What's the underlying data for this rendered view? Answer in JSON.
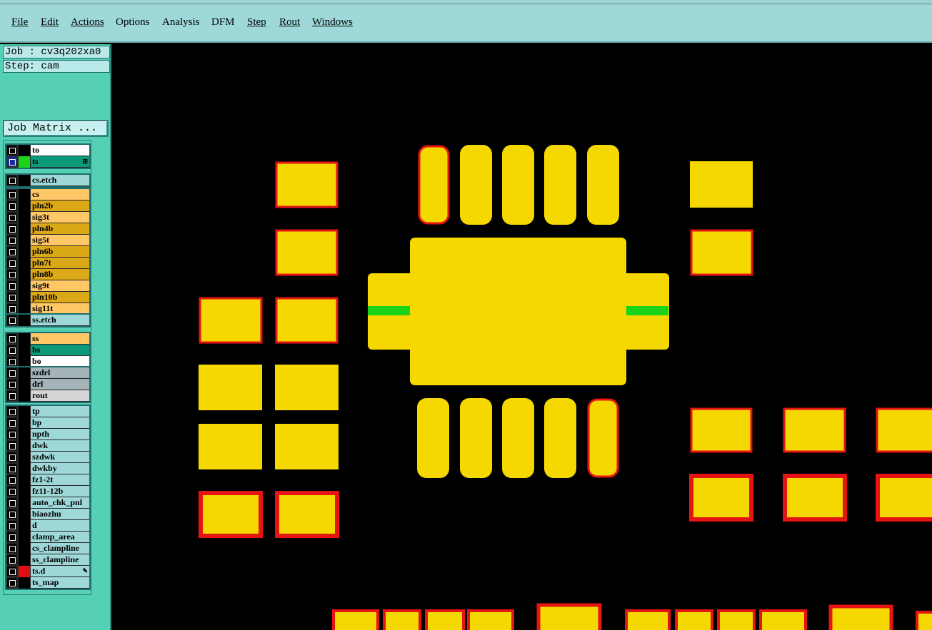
{
  "menu": [
    "File",
    "Edit",
    "Actions",
    "Options",
    "Analysis",
    "DFM",
    "Step",
    "Rout",
    "Windows"
  ],
  "job_label": "Job : cv3q202xa0",
  "step_label": "Step: cam",
  "job_matrix_label": "Job Matrix ...",
  "layer_groups": [
    [
      {
        "name": "to",
        "bg": "#ffffff"
      },
      {
        "name": "ts",
        "bg": "#0a9a7a",
        "swatch": "#19d419",
        "selected": true,
        "mark": "⊞"
      }
    ],
    [
      {
        "name": "cs.etch",
        "bg": "#9ed8d8"
      }
    ],
    [
      {
        "name": "cs",
        "bg": "#ffc766"
      },
      {
        "name": "pln2b",
        "bg": "#dba818"
      },
      {
        "name": "sig3t",
        "bg": "#ffc766"
      },
      {
        "name": "pln4b",
        "bg": "#dba818"
      },
      {
        "name": "sig5t",
        "bg": "#ffc766"
      },
      {
        "name": "pln6b",
        "bg": "#dba818"
      },
      {
        "name": "pln7t",
        "bg": "#dba818"
      },
      {
        "name": "pln8b",
        "bg": "#dba818"
      },
      {
        "name": "sig9t",
        "bg": "#ffc766"
      },
      {
        "name": "pln10b",
        "bg": "#dba818"
      },
      {
        "name": "sig11t",
        "bg": "#ffc766"
      }
    ],
    [
      {
        "name": "ss.etch",
        "bg": "#9ed8d8"
      }
    ],
    [
      {
        "name": "ss",
        "bg": "#ffc766"
      },
      {
        "name": "bs",
        "bg": "#0a9a7a"
      },
      {
        "name": "bo",
        "bg": "#ffffff"
      }
    ],
    [
      {
        "name": "szdrl",
        "bg": "#a4b3b8"
      },
      {
        "name": "drl",
        "bg": "#a4b3b8"
      },
      {
        "name": "rout",
        "bg": "#d5d5d5"
      }
    ],
    [
      {
        "name": "tp",
        "bg": "#9ed8d8"
      },
      {
        "name": "bp",
        "bg": "#9ed8d8"
      },
      {
        "name": "npth",
        "bg": "#9ed8d8"
      },
      {
        "name": "dwk",
        "bg": "#9ed8d8"
      },
      {
        "name": "szdwk",
        "bg": "#9ed8d8"
      },
      {
        "name": "dwkby",
        "bg": "#9ed8d8"
      },
      {
        "name": "fz1-2t",
        "bg": "#9ed8d8"
      },
      {
        "name": "fz11-12b",
        "bg": "#9ed8d8"
      },
      {
        "name": "auto_chk_pnl",
        "bg": "#9ed8d8"
      },
      {
        "name": "biaozhu",
        "bg": "#9ed8d8"
      },
      {
        "name": "d",
        "bg": "#9ed8d8"
      },
      {
        "name": "clamp_area",
        "bg": "#9ed8d8"
      },
      {
        "name": "cs_clampline",
        "bg": "#9ed8d8"
      },
      {
        "name": "ss_clampline",
        "bg": "#9ed8d8"
      },
      {
        "name": "ts.d",
        "bg": "#9ed8d8",
        "swatch": "#e01010",
        "mark": "✎"
      },
      {
        "name": "ts_map",
        "bg": "#9ed8d8"
      }
    ]
  ],
  "colors": {
    "pad": "#f5d800",
    "outline": "#e51414",
    "green": "#19d419",
    "background": "#000000"
  }
}
